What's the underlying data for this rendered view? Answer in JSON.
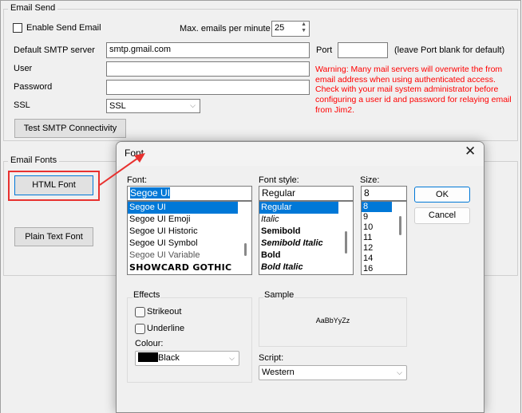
{
  "email_send": {
    "group_label": "Email Send",
    "enable_label": "Enable Send Email",
    "enable_checked": false,
    "max_label": "Max. emails per minute",
    "max_value": "25",
    "smtp_label": "Default SMTP server",
    "smtp_value": "smtp.gmail.com",
    "port_label": "Port",
    "port_value": "",
    "port_hint": "(leave Port blank for default)",
    "user_label": "User",
    "user_value": "",
    "password_label": "Password",
    "password_value": "",
    "ssl_label": "SSL",
    "ssl_value": "SSL",
    "warning_lines": [
      "Warning: Many mail servers will overwrite the from",
      "email address when using authenticated access.",
      "Check with your mail system administrator before",
      "configuring a user id and password for relaying email",
      "from Jim2."
    ],
    "test_button": "Test SMTP Connectivity"
  },
  "email_fonts": {
    "group_label": "Email Fonts",
    "html_font_button": "HTML Font",
    "plain_font_button": "Plain Text Font"
  },
  "annotation_color": "#e8312f",
  "font_dialog": {
    "title": "Font",
    "font_label": "Font:",
    "font_value": "Segoe UI",
    "fonts": [
      "Segoe UI",
      "Segoe UI Emoji",
      "Segoe UI Historic",
      "Segoe UI Symbol",
      "Segoe UI Variable",
      "SHOWCARD GOTHIC"
    ],
    "style_label": "Font style:",
    "style_value": "Regular",
    "styles": [
      "Regular",
      "Italic",
      "Semibold",
      "Semibold Italic",
      "Bold",
      "Bold Italic"
    ],
    "size_label": "Size:",
    "size_value": "8",
    "sizes": [
      "8",
      "9",
      "10",
      "11",
      "12",
      "14",
      "16"
    ],
    "ok": "OK",
    "cancel": "Cancel",
    "effects_label": "Effects",
    "strikeout": "Strikeout",
    "underline": "Underline",
    "colour_label": "Colour:",
    "colour_value": "Black",
    "sample_label": "Sample",
    "sample_text": "AaBbYyZz",
    "script_label": "Script:",
    "script_value": "Western",
    "selection_color": "#0078d7"
  }
}
